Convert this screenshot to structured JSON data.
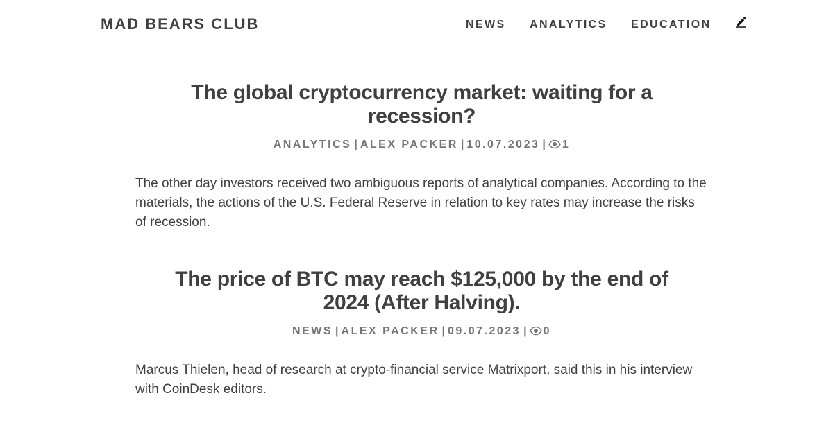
{
  "header": {
    "brand": "MAD BEARS CLUB",
    "nav": {
      "news": "NEWS",
      "analytics": "ANALYTICS",
      "education": "EDUCATION"
    },
    "edit_icon": "pencil-icon"
  },
  "posts": [
    {
      "title": "The global cryptocurrency market: waiting for a recession?",
      "category": "ANALYTICS",
      "author": "ALEX PACKER",
      "date": "10.07.2023",
      "views": "1",
      "separator": "|",
      "views_icon": "eye-icon",
      "excerpt": "The other day investors received two ambiguous reports of analytical companies. According to the materials, the actions of the U.S. Federal Reserve in relation to key rates may increase the risks of recession."
    },
    {
      "title": "The price of BTC may reach $125,000 by the end of 2024 (After Halving).",
      "category": "NEWS",
      "author": "ALEX PACKER",
      "date": "09.07.2023",
      "views": "0",
      "separator": "|",
      "views_icon": "eye-icon",
      "excerpt": "Marcus Thielen, head of research at crypto-financial service Matrixport, said this in his interview with CoinDesk editors."
    }
  ],
  "colors": {
    "text": "#404040",
    "meta": "#757575",
    "border": "#e6e6e6",
    "background": "#ffffff"
  }
}
